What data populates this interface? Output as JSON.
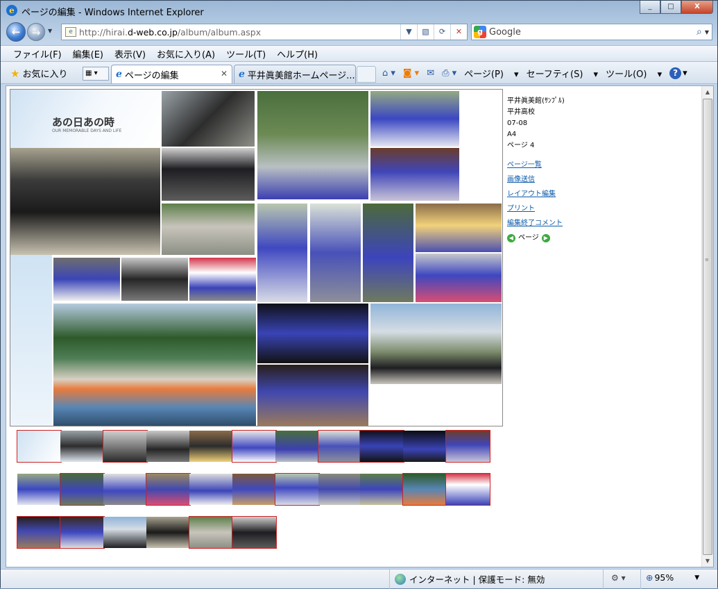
{
  "window": {
    "title": "ページの編集 - Windows Internet Explorer",
    "controls": [
      "_",
      "□",
      "X"
    ]
  },
  "address": {
    "url_prefix": "http://hirai.",
    "url_domain": "d-web.co.jp",
    "url_path": "/album/album.aspx"
  },
  "search": {
    "placeholder": "Google"
  },
  "menu": [
    "ファイル(F)",
    "編集(E)",
    "表示(V)",
    "お気に入り(A)",
    "ツール(T)",
    "ヘルプ(H)"
  ],
  "favorites_label": "お気に入り",
  "tabs": [
    {
      "label": "ページの編集",
      "active": true
    },
    {
      "label": "平井眞美館ホームページ...",
      "active": false
    }
  ],
  "command_bar": {
    "page": "ページ(P)",
    "safety": "セーフティ(S)",
    "tools": "ツール(O)"
  },
  "album": {
    "cover_title": "あの日あの時",
    "cover_subtitle": "OUR MEMORABLE DAYS AND LIFE"
  },
  "side": {
    "info": [
      "平井眞美館(ｻﾝﾌﾟﾙ)",
      "平井高校",
      "07-08",
      "A4",
      "ページ 4"
    ],
    "links": [
      "ページ一覧",
      "画像送信",
      "レイアウト編集",
      "プリント",
      "編集終了コメント"
    ],
    "pager_label": "ページ"
  },
  "status": {
    "zone": "インターネット | 保護モード: 無効",
    "zoom": "95%"
  },
  "colors": {
    "accent": "#0a5aa8",
    "thumb_selected_border": "#cc2222",
    "page_bg": "#ffffff"
  },
  "icons": [
    "ie-icon",
    "back-icon",
    "forward-icon",
    "refresh-icon",
    "stop-icon",
    "search-icon",
    "star-icon",
    "home-icon",
    "rss-icon",
    "mail-icon",
    "print-icon",
    "help-icon",
    "globe-icon",
    "zoom-icon"
  ]
}
